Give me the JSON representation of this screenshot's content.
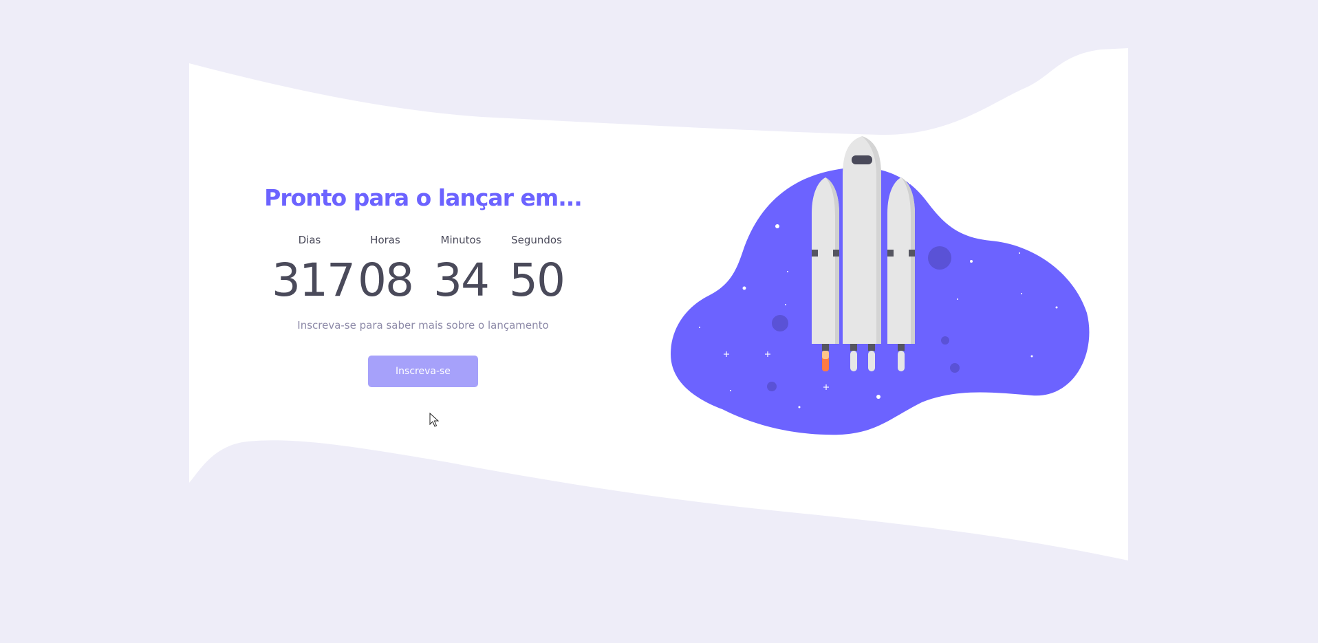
{
  "hero": {
    "headline": "Pronto para o lançar em...",
    "countdown": [
      {
        "label": "Dias",
        "value": "317"
      },
      {
        "label": "Horas",
        "value": "08"
      },
      {
        "label": "Minutos",
        "value": "34"
      },
      {
        "label": "Segundos",
        "value": "50"
      }
    ],
    "subtitle": "Inscreva-se para saber mais sobre o lançamento",
    "cta_label": "Inscreva-se"
  },
  "colors": {
    "background": "#eeedf8",
    "card": "#ffffff",
    "accent": "#6c63ff",
    "button": "#a6a1fa",
    "text": "#4a4a5a",
    "muted": "#8d8aa8",
    "rocket": "#e6e6e6"
  },
  "illustration": {
    "icon": "rocket-launch-illustration"
  }
}
